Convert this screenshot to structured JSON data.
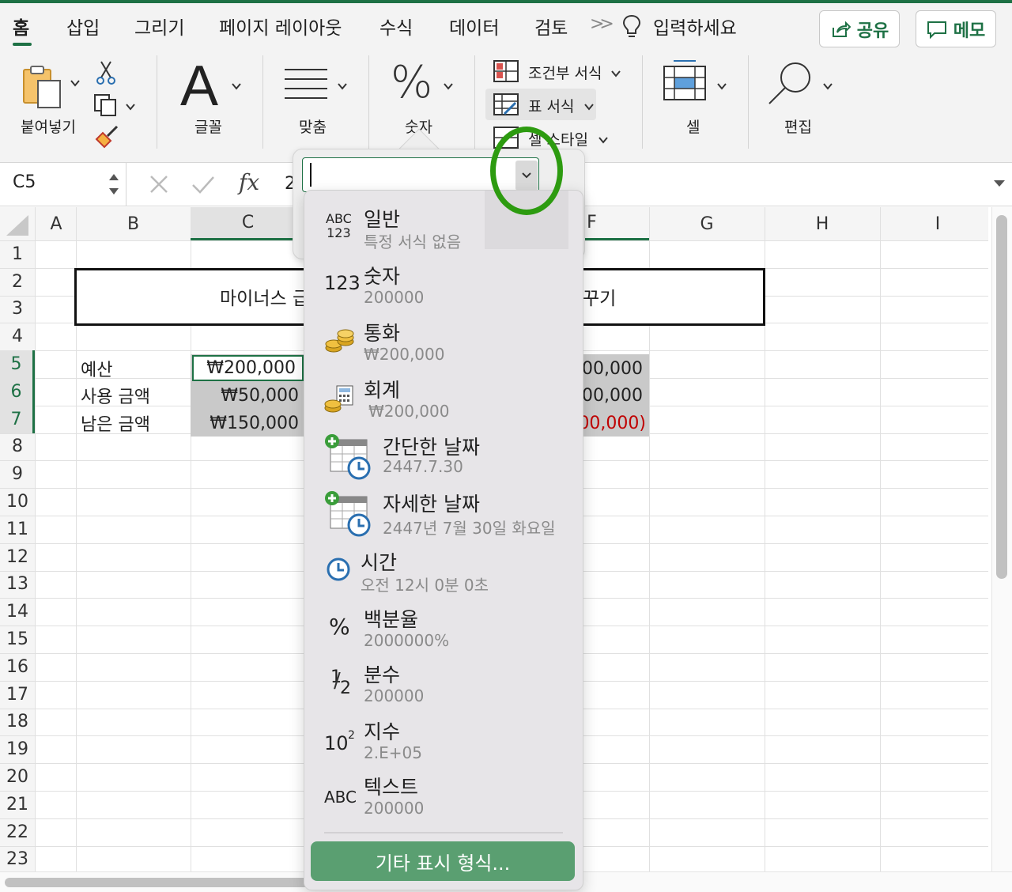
{
  "tabs": [
    "홈",
    "삽입",
    "그리기",
    "페이지 레이아웃",
    "수식",
    "데이터",
    "검토"
  ],
  "tell_me": "입력하세요",
  "share_label": "공유",
  "memo_label": "메모",
  "ribbon": {
    "paste": "붙여넣기",
    "font": "글꼴",
    "align": "맞춤",
    "number": "숫자",
    "conditional": "조건부 서식",
    "table_format": "표 서식",
    "cell_style": "셀 스타일",
    "cells": "셀",
    "edit": "편집"
  },
  "formula_bar": {
    "name_box": "C5",
    "formula_partial": "2"
  },
  "columns": [
    "A",
    "B",
    "C",
    "F",
    "G",
    "H",
    "I"
  ],
  "rows": [
    "1",
    "2",
    "3",
    "4",
    "5",
    "6",
    "7",
    "8",
    "9",
    "10",
    "11",
    "12",
    "13",
    "14",
    "15",
    "16",
    "17",
    "18",
    "19",
    "20",
    "21",
    "22",
    "23"
  ],
  "sheet": {
    "title_left": "마이너스 급",
    "title_right": "꾸기",
    "labels": [
      "예산",
      "사용 금액",
      "남은 금액"
    ],
    "c_values": [
      "₩200,000",
      "₩50,000",
      "₩150,000"
    ],
    "f_values": [
      "00,000",
      "00,000",
      "00,000)"
    ]
  },
  "number_format_menu": {
    "items": [
      {
        "title": "일반",
        "sample": "특정 서식 없음",
        "icon": "abc-123-icon"
      },
      {
        "title": "숫자",
        "sample": "200000",
        "icon": "123-icon"
      },
      {
        "title": "통화",
        "sample": "₩200,000",
        "icon": "coins-icon"
      },
      {
        "title": "회계",
        "sample": "₩200,000",
        "icon": "calculator-coins-icon"
      },
      {
        "title": "간단한 날짜",
        "sample": "2447.7.30",
        "icon": "calendar-clock-icon"
      },
      {
        "title": "자세한 날짜",
        "sample": "2447년 7월 30일 화요일",
        "icon": "calendar-clock-icon"
      },
      {
        "title": "시간",
        "sample": "오전 12시 0분 0초",
        "icon": "clock-icon"
      },
      {
        "title": "백분율",
        "sample": "2000000%",
        "icon": "percent-icon"
      },
      {
        "title": "분수",
        "sample": "200000",
        "icon": "fraction-icon"
      },
      {
        "title": "지수",
        "sample": "2.E+05",
        "icon": "exponent-icon"
      },
      {
        "title": "텍스트",
        "sample": "200000",
        "icon": "abc-icon"
      }
    ],
    "more_formats": "기타 표시 형식...",
    "icon_text": {
      "abc": "ABC",
      "n123": "123",
      "percent": "%",
      "fraction_num": "1",
      "fraction_den": "2",
      "exp_base": "10",
      "exp_pow": "2"
    }
  },
  "colors": {
    "accent": "#1e7145",
    "annotation": "#2d9b10",
    "button": "#5a9f71",
    "negative": "#c00000"
  }
}
